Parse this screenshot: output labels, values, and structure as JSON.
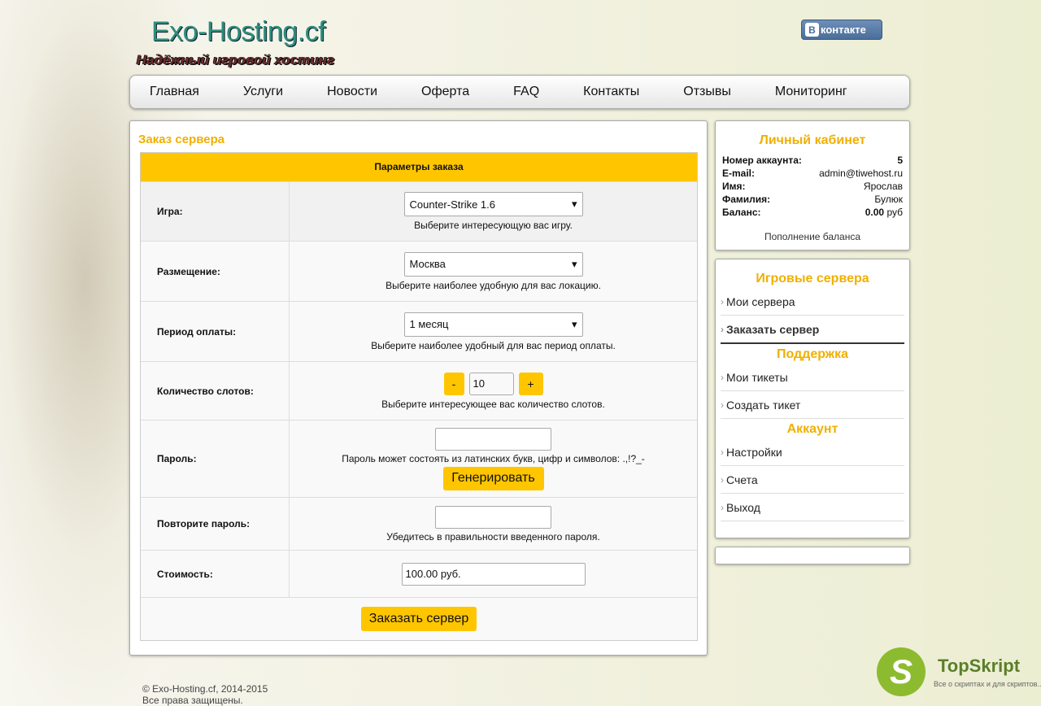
{
  "header": {
    "logo": "Exo-Hosting.cf",
    "slogan": "Надёжный игровой хостинг",
    "vk_label": "контакте",
    "vk_letter": "B"
  },
  "nav": [
    "Главная",
    "Услуги",
    "Новости",
    "Оферта",
    "FAQ",
    "Контакты",
    "Отзывы",
    "Мониторинг"
  ],
  "order": {
    "title": "Заказ сервера",
    "table_header": "Параметры заказа",
    "game": {
      "label": "Игра:",
      "value": "Counter-Strike 1.6",
      "hint": "Выберите интересующую вас игру."
    },
    "location": {
      "label": "Размещение:",
      "value": "Москва",
      "hint": "Выберите наиболее удобную для вас локацию."
    },
    "period": {
      "label": "Период оплаты:",
      "value": "1 месяц",
      "hint": "Выберите наиболее удобный для вас период оплаты."
    },
    "slots": {
      "label": "Количество слотов:",
      "minus": "-",
      "value": "10",
      "plus": "+",
      "hint": "Выберите интересующее вас количество слотов."
    },
    "password": {
      "label": "Пароль:",
      "hint": "Пароль может состоять из латинских букв, цифр и символов: .,!?_-",
      "generate": "Генерировать"
    },
    "password_repeat": {
      "label": "Повторите пароль:",
      "hint": "Убедитесь в правильности введенного пароля."
    },
    "cost": {
      "label": "Стоимость:",
      "value": "100.00 руб."
    },
    "submit": "Заказать сервер"
  },
  "account": {
    "title": "Личный кабинет",
    "rows": [
      {
        "k": "Номер аккаунта:",
        "v": "5"
      },
      {
        "k": "E-mail:",
        "v": "admin@tiwehost.ru"
      },
      {
        "k": "Имя:",
        "v": "Ярослав"
      },
      {
        "k": "Фамилия:",
        "v": "Булюк"
      }
    ],
    "balance_label": "Баланс:",
    "balance_value": "0.00",
    "balance_unit": " руб",
    "topup": "Пополнение баланса"
  },
  "sidebar": {
    "game_title": "Игровые сервера",
    "game_items": [
      "Мои сервера",
      "Заказать сервер"
    ],
    "support_title": "Поддержка",
    "support_items": [
      "Мои тикеты",
      "Создать тикет"
    ],
    "account_title": "Аккаунт",
    "account_items": [
      "Настройки",
      "Счета",
      "Выход"
    ]
  },
  "footer": {
    "line1": "© Exo-Hosting.cf, 2014-2015",
    "line2": "Все права защищены."
  },
  "watermark": {
    "letter": "S",
    "name": "TopSkript",
    "sub": "Все о скриптах и для скриптов..."
  },
  "colors": {
    "accent": "#ffc600",
    "title": "#f0b000"
  }
}
